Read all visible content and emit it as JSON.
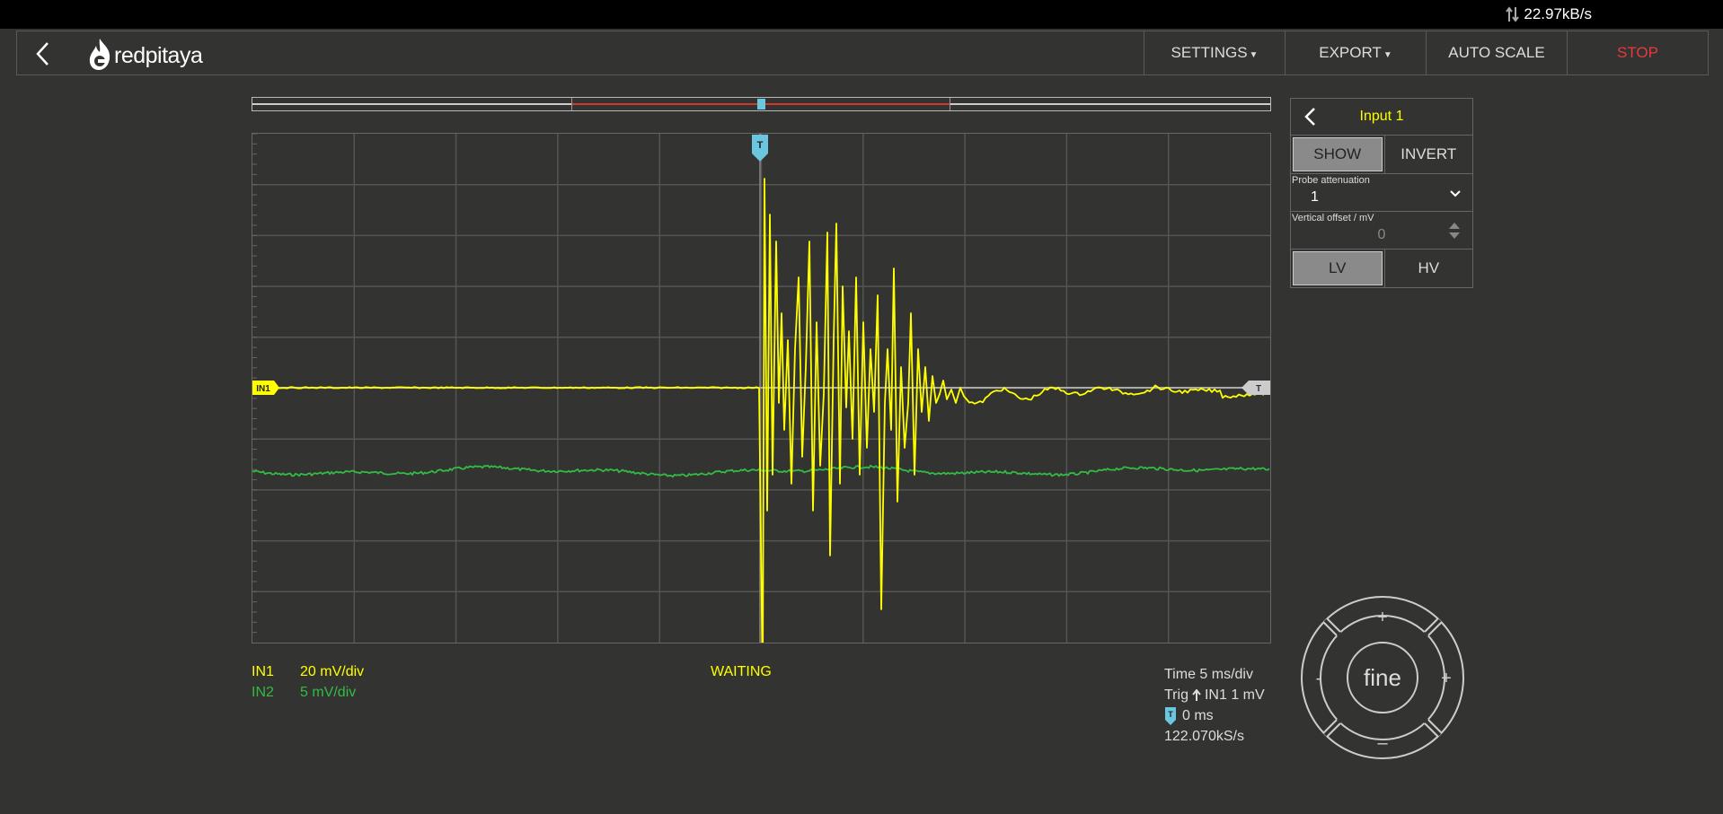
{
  "status_bar": {
    "data_rate": "22.97kB/s"
  },
  "navbar": {
    "brand": "redpitaya",
    "menu": {
      "settings": "SETTINGS",
      "export": "EXPORT",
      "autoscale": "AUTO SCALE",
      "stop": "STOP"
    }
  },
  "plot": {
    "trigger_marker": "T",
    "channel1_marker": "IN1",
    "trigger_level_marker": "T"
  },
  "channels": [
    {
      "name": "IN1",
      "scale": "20 mV/div",
      "color": "#ffff00"
    },
    {
      "name": "IN2",
      "scale": "5 mV/div",
      "color": "#33bb44"
    }
  ],
  "acquisition": {
    "status": "WAITING",
    "time": "Time 5 ms/div",
    "trigger": "IN1 1 mV",
    "trigger_prefix": "Trig",
    "trigger_delay": "0 ms",
    "sample_rate": "122.070kS/s"
  },
  "input_panel": {
    "title": "Input 1",
    "show_label": "SHOW",
    "invert_label": "INVERT",
    "probe_label": "Probe attenuation",
    "probe_value": "1",
    "offset_label": "Vertical offset / mV",
    "offset_value": "0",
    "lv_label": "LV",
    "hv_label": "HV"
  },
  "dpad": {
    "center": "fine",
    "up": "+",
    "down": "–",
    "left": "-",
    "right": "+"
  }
}
